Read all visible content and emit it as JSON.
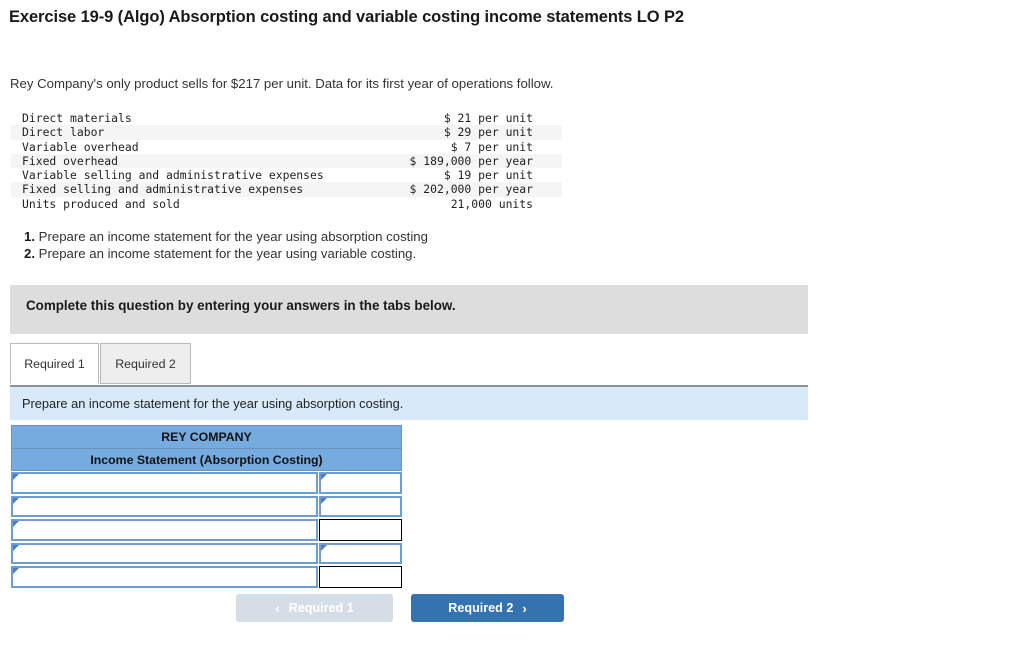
{
  "title": "Exercise 19-9 (Algo) Absorption costing and variable costing income statements LO P2",
  "intro": "Rey Company's only product sells for $217 per unit. Data for its first year of operations follow.",
  "facts": {
    "rows": [
      {
        "label": "Direct materials",
        "value": "$ 21 per unit"
      },
      {
        "label": "Direct labor",
        "value": "$ 29 per unit"
      },
      {
        "label": "Variable overhead",
        "value": "$ 7 per unit"
      },
      {
        "label": "Fixed overhead",
        "value": "$ 189,000 per year"
      },
      {
        "label": "Variable selling and administrative expenses",
        "value": "$ 19 per unit"
      },
      {
        "label": "Fixed selling and administrative expenses",
        "value": "$ 202,000 per year"
      },
      {
        "label": "Units produced and sold",
        "value": "21,000 units"
      }
    ]
  },
  "requirements": [
    {
      "num": "1.",
      "text": "Prepare an income statement for the year using absorption costing"
    },
    {
      "num": "2.",
      "text": "Prepare an income statement for the year using variable costing."
    }
  ],
  "gray_banner": {
    "text": "Complete this question by entering your answers in the tabs below."
  },
  "tabs": [
    {
      "label": "Required 1",
      "active": true
    },
    {
      "label": "Required 2",
      "active": false
    }
  ],
  "blue_bar": {
    "text": "Prepare an income statement for the year using absorption costing."
  },
  "sheet": {
    "company": "REY COMPANY",
    "statement": "Income Statement (Absorption Costing)",
    "rows": [
      {
        "label": "",
        "amount": "",
        "label_style": "blue",
        "amount_style": "blue"
      },
      {
        "label": "",
        "amount": "",
        "label_style": "blue",
        "amount_style": "blue"
      },
      {
        "label": "",
        "amount": "",
        "label_style": "blue",
        "amount_style": "black"
      },
      {
        "label": "",
        "amount": "",
        "label_style": "blue",
        "amount_style": "blue"
      },
      {
        "label": "",
        "amount": "",
        "label_style": "blue",
        "amount_style": "black"
      }
    ]
  },
  "nav": {
    "prev_label": "Required 1",
    "prev_icon": "chevron-left-icon",
    "prev_glyph": "‹",
    "next_label": "Required 2",
    "next_icon": "chevron-right-icon",
    "next_glyph": "›"
  },
  "colors": {
    "header_blue": "#76abe0",
    "action_blue": "#3572b0",
    "disabled_blue": "#d5dee7",
    "info_blue": "#d8eafa",
    "banner_gray": "#dddddd",
    "input_border_blue": "#6d9dd1"
  }
}
